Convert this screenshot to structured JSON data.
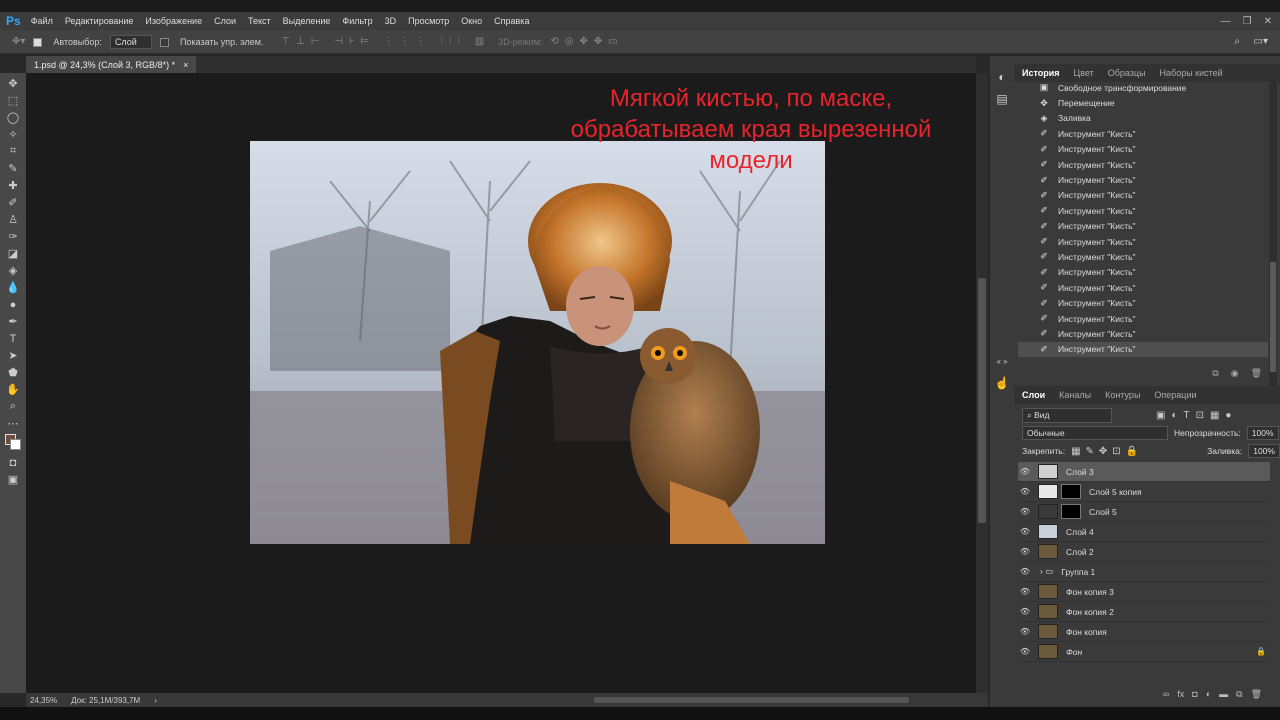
{
  "menubar": {
    "logo": "Ps",
    "items": [
      "Файл",
      "Редактирование",
      "Изображение",
      "Слои",
      "Текст",
      "Выделение",
      "Фильтр",
      "3D",
      "Просмотр",
      "Окно",
      "Справка"
    ],
    "window_controls": [
      "—",
      "❐",
      "✕"
    ]
  },
  "options": {
    "autoselect_label": "Автовыбор:",
    "autoselect_value": "Слой",
    "show_controls_label": "Показать упр. элем.",
    "mode_3d_label": "3D-режим:"
  },
  "document": {
    "tab_title": "1.psd @ 24,3% (Слой 3, RGB/8*) *",
    "close": "×",
    "overlay_text": [
      "Мягкой кистью, по маске,",
      "обрабатываем края вырезенной",
      "модели"
    ]
  },
  "status": {
    "zoom": "24,35%",
    "doc_info": "Док: 25,1M/393,7M"
  },
  "history_panel": {
    "tabs": [
      "История",
      "Цвет",
      "Образцы",
      "Наборы кистей"
    ],
    "items": [
      {
        "icon": "transform-icon",
        "label": "Свободное трансформирование"
      },
      {
        "icon": "move-icon",
        "label": "Перемещение"
      },
      {
        "icon": "fill-icon",
        "label": "Заливка"
      },
      {
        "icon": "brush-icon",
        "label": "Инструмент \"Кисть\""
      },
      {
        "icon": "brush-icon",
        "label": "Инструмент \"Кисть\""
      },
      {
        "icon": "brush-icon",
        "label": "Инструмент \"Кисть\""
      },
      {
        "icon": "brush-icon",
        "label": "Инструмент \"Кисть\""
      },
      {
        "icon": "brush-icon",
        "label": "Инструмент \"Кисть\""
      },
      {
        "icon": "brush-icon",
        "label": "Инструмент \"Кисть\""
      },
      {
        "icon": "brush-icon",
        "label": "Инструмент \"Кисть\""
      },
      {
        "icon": "brush-icon",
        "label": "Инструмент \"Кисть\""
      },
      {
        "icon": "brush-icon",
        "label": "Инструмент \"Кисть\""
      },
      {
        "icon": "brush-icon",
        "label": "Инструмент \"Кисть\""
      },
      {
        "icon": "brush-icon",
        "label": "Инструмент \"Кисть\""
      },
      {
        "icon": "brush-icon",
        "label": "Инструмент \"Кисть\""
      },
      {
        "icon": "brush-icon",
        "label": "Инструмент \"Кисть\""
      },
      {
        "icon": "brush-icon",
        "label": "Инструмент \"Кисть\""
      },
      {
        "icon": "brush-icon",
        "label": "Инструмент \"Кисть\""
      }
    ]
  },
  "layers_panel": {
    "tabs": [
      "Слои",
      "Каналы",
      "Контуры",
      "Операции"
    ],
    "filter_label": "Вид",
    "blend_mode": "Обычные",
    "opacity_label": "Непрозрачность:",
    "opacity_value": "100%",
    "lock_label": "Закрепить:",
    "fill_label": "Заливка:",
    "fill_value": "100%",
    "layers": [
      {
        "name": "Слой 3",
        "selected": true,
        "mask": false,
        "thumb": "#cfcfcf"
      },
      {
        "name": "Слой 5 копия",
        "selected": false,
        "mask": true,
        "thumb": "#e8e8e8"
      },
      {
        "name": "Слой 5",
        "selected": false,
        "mask": true,
        "thumb": "#3a3a3a"
      },
      {
        "name": "Слой 4",
        "selected": false,
        "mask": false,
        "thumb": "#c8d0dc"
      },
      {
        "name": "Слой 2",
        "selected": false,
        "mask": false,
        "thumb": "#6b5a3c"
      },
      {
        "name": "Группа 1",
        "selected": false,
        "mask": false,
        "thumb": "folder"
      },
      {
        "name": "Фон копия 3",
        "selected": false,
        "mask": false,
        "thumb": "#6b5a3c"
      },
      {
        "name": "Фон копия 2",
        "selected": false,
        "mask": false,
        "thumb": "#6b5a3c"
      },
      {
        "name": "Фон копия",
        "selected": false,
        "mask": false,
        "thumb": "#6b5a3c"
      },
      {
        "name": "Фон",
        "selected": false,
        "mask": false,
        "thumb": "#6b5a3c"
      }
    ]
  }
}
